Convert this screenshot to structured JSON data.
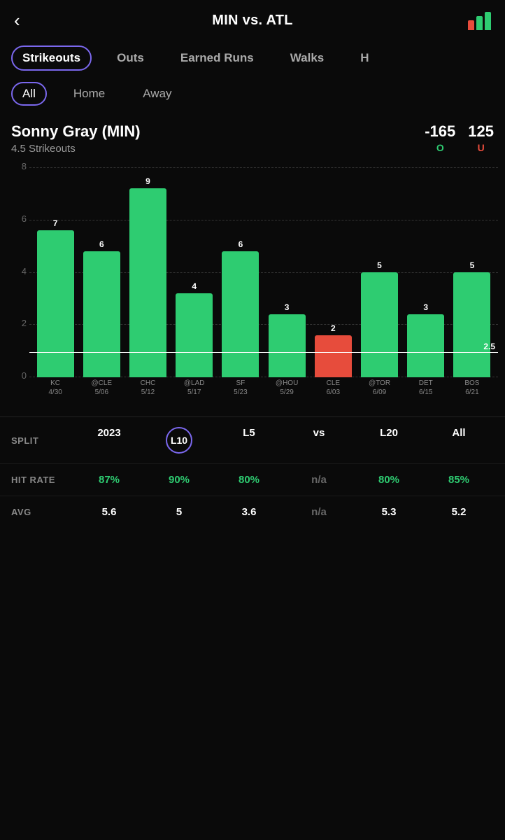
{
  "header": {
    "back_label": "‹",
    "title": "MIN vs. ATL"
  },
  "category_tabs": [
    {
      "label": "Strikeouts",
      "active": true
    },
    {
      "label": "Outs",
      "active": false
    },
    {
      "label": "Earned Runs",
      "active": false
    },
    {
      "label": "Walks",
      "active": false
    },
    {
      "label": "H",
      "active": false
    }
  ],
  "filter_tabs": [
    {
      "label": "All",
      "active": true
    },
    {
      "label": "Home",
      "active": false
    },
    {
      "label": "Away",
      "active": false
    }
  ],
  "player": {
    "name": "Sonny Gray (MIN)",
    "stat_line": "4.5 Strikeouts",
    "odds_neg": "-165",
    "odds_pos": "125",
    "odds_over_label": "O",
    "odds_under_label": "U"
  },
  "chart": {
    "y_labels": [
      "8",
      "6",
      "4",
      "2",
      "0"
    ],
    "threshold": "2.5",
    "bars": [
      {
        "game": "KC",
        "date": "4/30",
        "value": 7,
        "color": "green"
      },
      {
        "game": "@CLE",
        "date": "5/06",
        "value": 6,
        "color": "green"
      },
      {
        "game": "CHC",
        "date": "5/12",
        "value": 9,
        "color": "green"
      },
      {
        "game": "@LAD",
        "date": "5/17",
        "value": 4,
        "color": "green"
      },
      {
        "game": "SF",
        "date": "5/23",
        "value": 6,
        "color": "green"
      },
      {
        "game": "@HOU",
        "date": "5/29",
        "value": 3,
        "color": "green"
      },
      {
        "game": "CLE",
        "date": "6/03",
        "value": 2,
        "color": "red"
      },
      {
        "game": "@TOR",
        "date": "6/09",
        "value": 5,
        "color": "green"
      },
      {
        "game": "DET",
        "date": "6/15",
        "value": 3,
        "color": "green"
      },
      {
        "game": "BOS",
        "date": "6/21",
        "value": 5,
        "color": "green"
      }
    ],
    "max_value": 10
  },
  "stats": {
    "split_label": "SPLIT",
    "hit_rate_label": "HIT RATE",
    "avg_label": "AVG",
    "columns": [
      {
        "header": "2023",
        "hit_rate": "87%",
        "avg": "5.6",
        "is_circle": false
      },
      {
        "header": "L10",
        "hit_rate": "90%",
        "avg": "5",
        "is_circle": true
      },
      {
        "header": "L5",
        "hit_rate": "80%",
        "avg": "3.6",
        "is_circle": false
      },
      {
        "header": "vs",
        "hit_rate": "n/a",
        "avg": "n/a",
        "is_circle": false
      },
      {
        "header": "L20",
        "hit_rate": "80%",
        "avg": "5.3",
        "is_circle": false
      },
      {
        "header": "All",
        "hit_rate": "85%",
        "avg": "5.2",
        "is_circle": false
      }
    ]
  }
}
